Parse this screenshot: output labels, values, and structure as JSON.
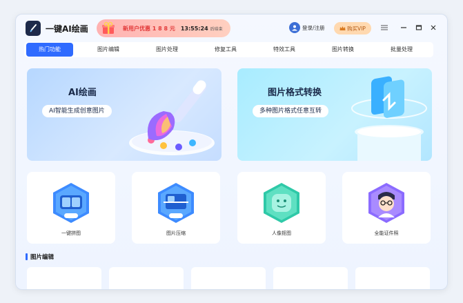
{
  "app": {
    "name": "一键AI绘画"
  },
  "promo": {
    "text": "新用户优惠 1 8 8 元",
    "countdown": "13:55:24",
    "suffix": "后结束"
  },
  "header": {
    "login_label": "登录/注册",
    "vip_label": "购买VIP"
  },
  "tabs": [
    {
      "label": "热门功能",
      "active": true
    },
    {
      "label": "图片编辑",
      "active": false
    },
    {
      "label": "图片处理",
      "active": false
    },
    {
      "label": "修复工具",
      "active": false
    },
    {
      "label": "特效工具",
      "active": false
    },
    {
      "label": "图片转换",
      "active": false
    },
    {
      "label": "批量处理",
      "active": false
    }
  ],
  "banners": {
    "ai": {
      "title": "AI绘画",
      "subtitle": "AI智能生成创意图片"
    },
    "format": {
      "title": "图片格式转换",
      "subtitle": "多种图片格式任意互转"
    }
  },
  "features": [
    {
      "label": "一键拼图",
      "icon": "collage-icon"
    },
    {
      "label": "图片压缩",
      "icon": "compress-icon"
    },
    {
      "label": "人像抠图",
      "icon": "portrait-cutout-icon"
    },
    {
      "label": "全能证件照",
      "icon": "id-photo-icon"
    }
  ],
  "section": {
    "title": "图片编辑"
  },
  "colors": {
    "accent": "#2f6bff",
    "promo": "#e23a3a",
    "vip": "#ffd9b0"
  }
}
